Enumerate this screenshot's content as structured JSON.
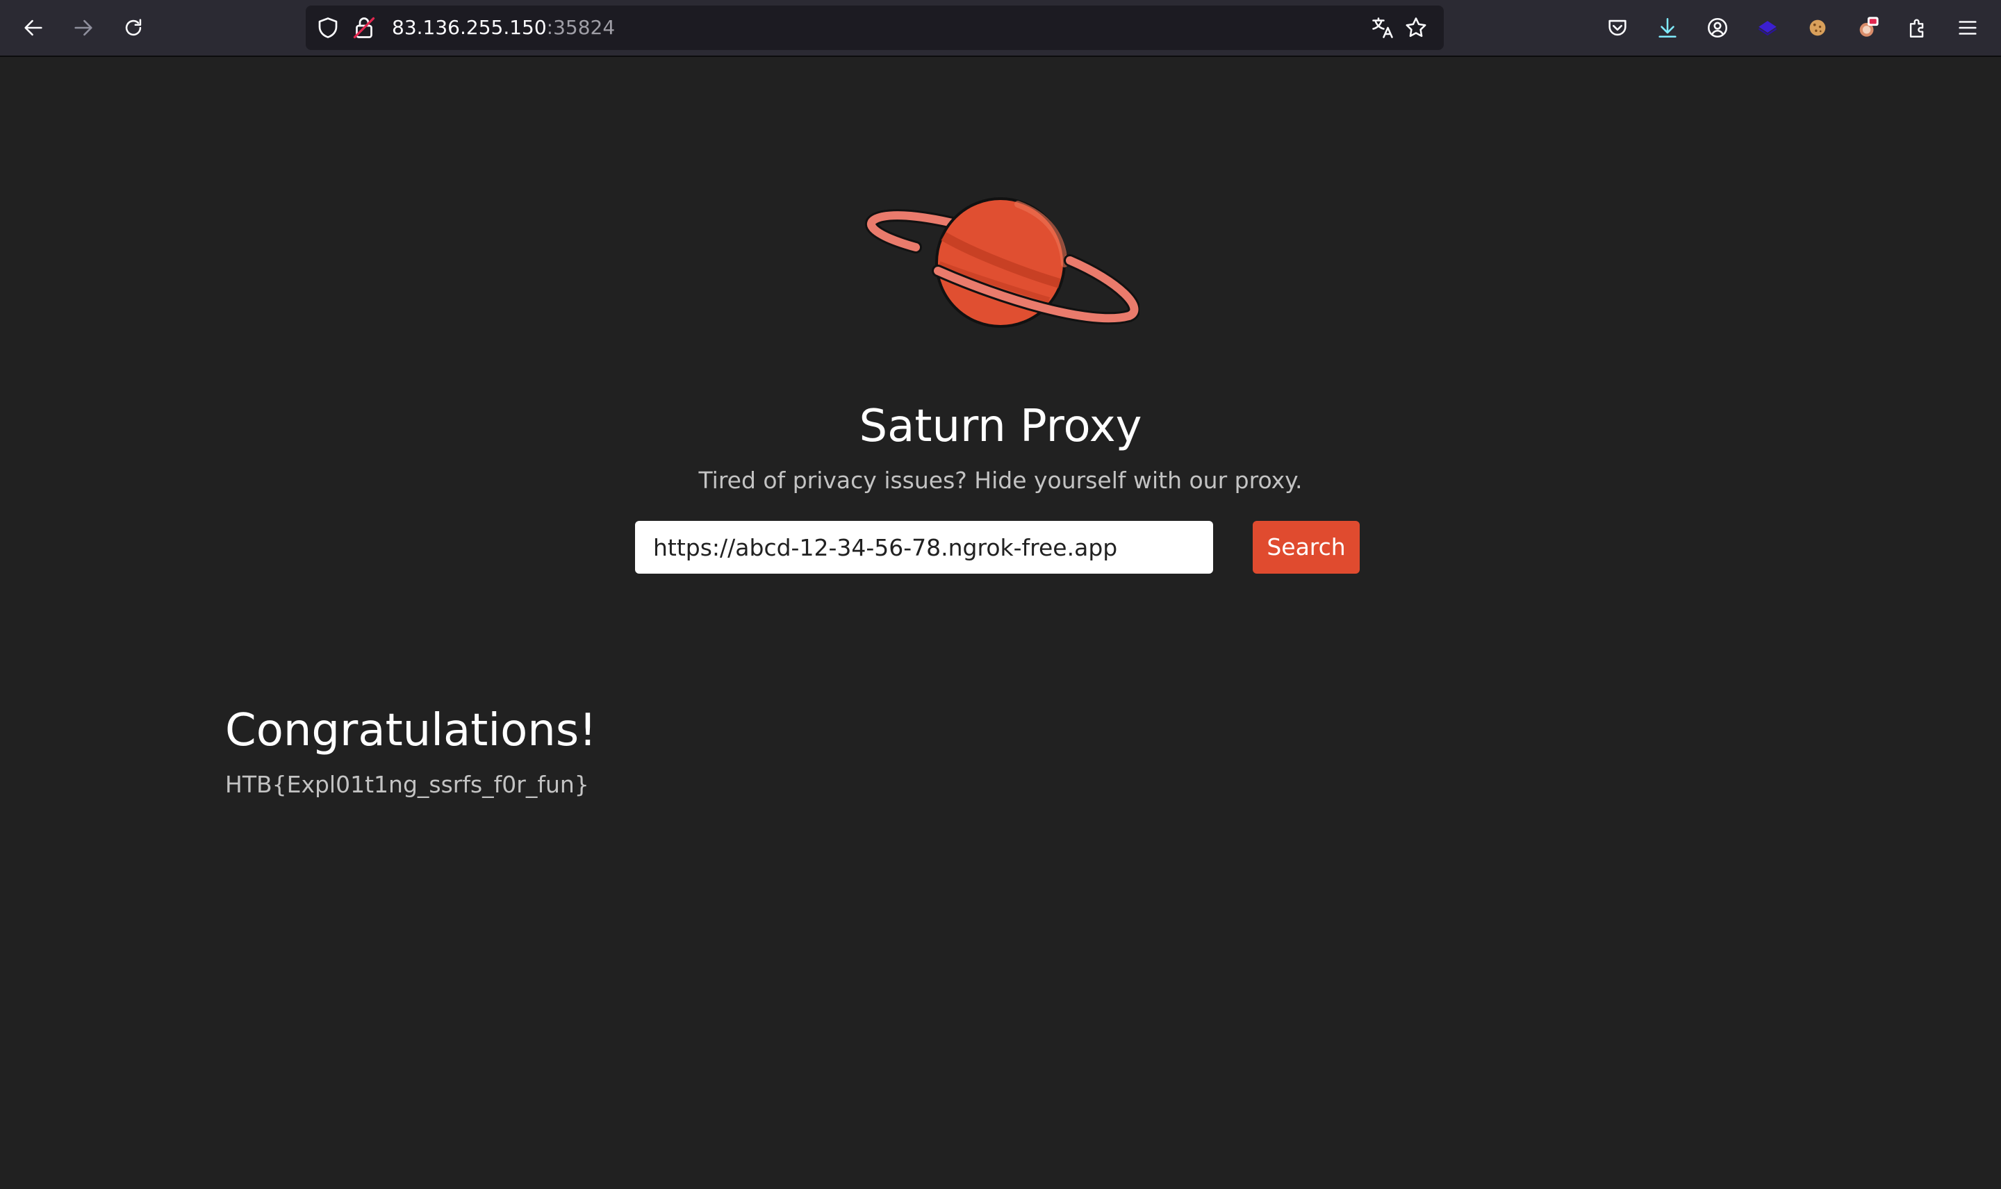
{
  "browser": {
    "url_host": "83.136.255.150",
    "url_port": ":35824",
    "icons": [
      "back-icon",
      "forward-icon",
      "reload-icon",
      "shield-icon",
      "insecure-lock-icon",
      "translate-icon",
      "bookmark-star-icon",
      "pocket-icon",
      "download-icon",
      "account-icon",
      "extension-blue-icon",
      "cookie-icon",
      "extension-badge-icon",
      "extensions-icon",
      "menu-icon"
    ]
  },
  "page": {
    "title": "Saturn Proxy",
    "subtitle": "Tired of privacy issues? Hide yourself with our proxy.",
    "search": {
      "value": "https://abcd-12-34-56-78.ngrok-free.app",
      "button_label": "Search"
    },
    "result": {
      "title": "Congratulations!",
      "flag": "HTB{Expl01t1ng_ssrfs_f0r_fun}"
    }
  },
  "colors": {
    "background": "#212121",
    "accent": "#e04b2f",
    "planet": "#e04f31",
    "ring": "#ea7b6c"
  }
}
